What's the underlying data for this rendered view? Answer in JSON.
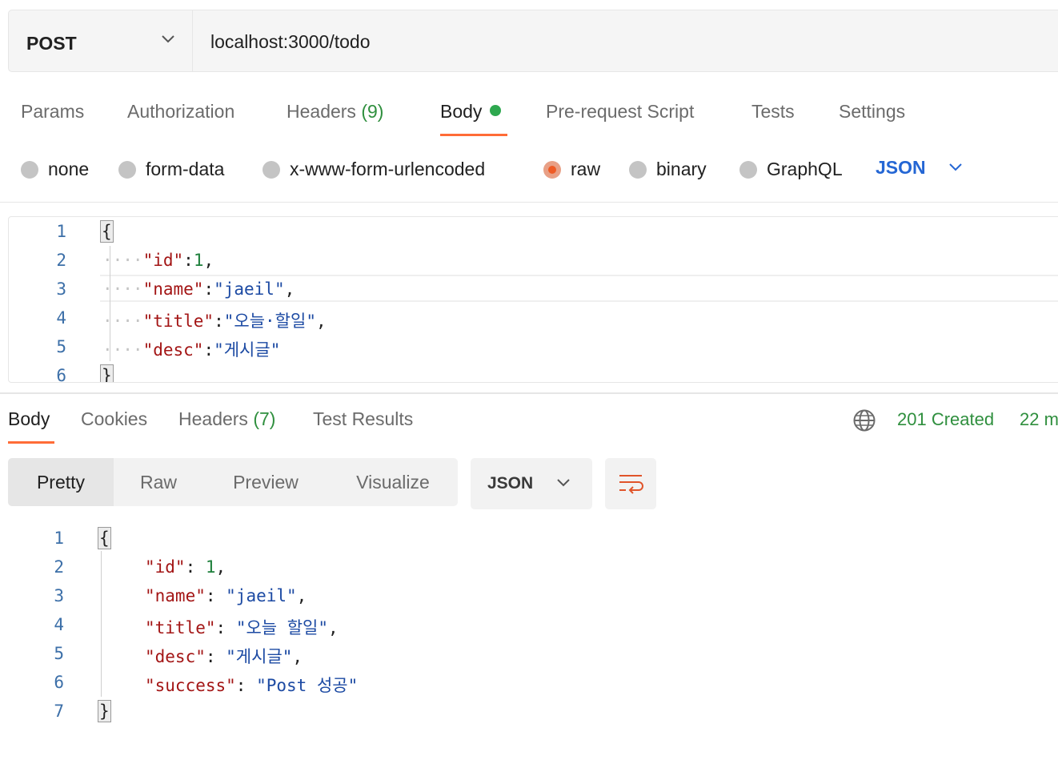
{
  "request": {
    "method": "POST",
    "url": "localhost:3000/todo",
    "tabs": {
      "params": "Params",
      "authorization": "Authorization",
      "headers": "Headers",
      "headers_count": "(9)",
      "body": "Body",
      "prerequest": "Pre-request Script",
      "tests": "Tests",
      "settings": "Settings"
    },
    "active_tab": "Body",
    "body_types": {
      "none": "none",
      "form_data": "form-data",
      "urlencoded": "x-www-form-urlencoded",
      "raw": "raw",
      "binary": "binary",
      "graphql": "GraphQL"
    },
    "selected_body_type": "raw",
    "language": "JSON",
    "editor": {
      "line_numbers": [
        "1",
        "2",
        "3",
        "4",
        "5",
        "6"
      ],
      "open_brace": "{",
      "close_brace": "}",
      "lines": [
        {
          "key": "\"id\"",
          "sep": ":",
          "value": "1",
          "trail": ","
        },
        {
          "key": "\"name\"",
          "sep": ":",
          "value": "\"jaeil\"",
          "trail": ","
        },
        {
          "key": "\"title\"",
          "sep": ":",
          "value": "\"오늘·할일\"",
          "trail": ","
        },
        {
          "key": "\"desc\"",
          "sep": ":",
          "value": "\"게시글\"",
          "trail": ""
        }
      ],
      "indent_marker": "····"
    }
  },
  "response": {
    "tabs": {
      "body": "Body",
      "cookies": "Cookies",
      "headers": "Headers",
      "headers_count": "(7)",
      "test_results": "Test Results"
    },
    "active_tab": "Body",
    "status": "201 Created",
    "time": "22 m",
    "view_modes": {
      "pretty": "Pretty",
      "raw": "Raw",
      "preview": "Preview",
      "visualize": "Visualize"
    },
    "active_view": "Pretty",
    "format": "JSON",
    "editor": {
      "line_numbers": [
        "1",
        "2",
        "3",
        "4",
        "5",
        "6",
        "7"
      ],
      "open_brace": "{",
      "close_brace": "}",
      "lines": [
        {
          "key": "\"id\"",
          "sep": ": ",
          "value": "1",
          "trail": ","
        },
        {
          "key": "\"name\"",
          "sep": ": ",
          "value": "\"jaeil\"",
          "trail": ","
        },
        {
          "key": "\"title\"",
          "sep": ": ",
          "value": "\"오늘 할일\"",
          "trail": ","
        },
        {
          "key": "\"desc\"",
          "sep": ": ",
          "value": "\"게시글\"",
          "trail": ","
        },
        {
          "key": "\"success\"",
          "sep": ": ",
          "value": "\"Post 성공\"",
          "trail": ""
        }
      ]
    }
  },
  "colors": {
    "accent": "#ff6c37",
    "status_green": "#2f8f3e",
    "json_blue": "#2466d4",
    "key_red": "#a31515",
    "string_blue": "#1c4aa3",
    "number_green": "#1d7f3b"
  }
}
